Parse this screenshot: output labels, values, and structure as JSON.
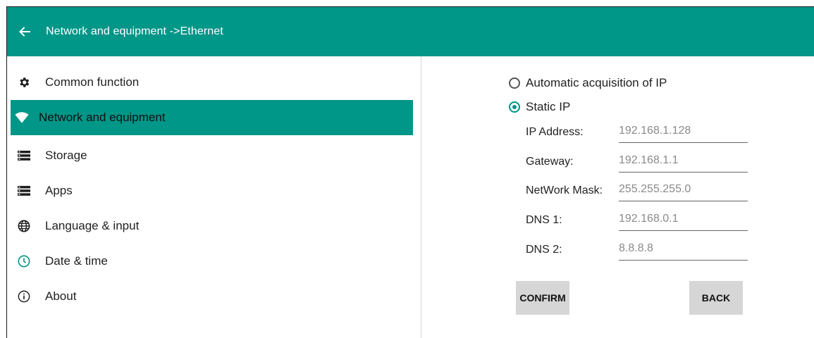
{
  "header": {
    "title": "Network and equipment ->Ethernet"
  },
  "sidebar": {
    "items": [
      {
        "label": "Common function",
        "icon": "gear-icon",
        "active": false
      },
      {
        "label": "Network and equipment",
        "icon": "wifi-icon",
        "active": true
      },
      {
        "label": "Storage",
        "icon": "storage-icon",
        "active": false
      },
      {
        "label": "Apps",
        "icon": "apps-icon",
        "active": false
      },
      {
        "label": "Language & input",
        "icon": "globe-icon",
        "active": false
      },
      {
        "label": "Date & time",
        "icon": "clock-icon",
        "active": false
      },
      {
        "label": "About",
        "icon": "info-icon",
        "active": false
      }
    ]
  },
  "ip_mode": {
    "options": [
      {
        "label": "Automatic acquisition of IP",
        "selected": false
      },
      {
        "label": "Static IP",
        "selected": true
      }
    ]
  },
  "fields": [
    {
      "label": "IP Address:",
      "value": "192.168.1.128"
    },
    {
      "label": "Gateway:",
      "value": "192.168.1.1"
    },
    {
      "label": "NetWork Mask:",
      "value": "255.255.255.0"
    },
    {
      "label": "DNS 1:",
      "value": "192.168.0.1"
    },
    {
      "label": "DNS 2:",
      "value": "8.8.8.8"
    }
  ],
  "buttons": {
    "confirm": "CONFIRM",
    "back": "BACK"
  },
  "colors": {
    "accent": "#009688",
    "button_bg": "#d6d6d6"
  }
}
